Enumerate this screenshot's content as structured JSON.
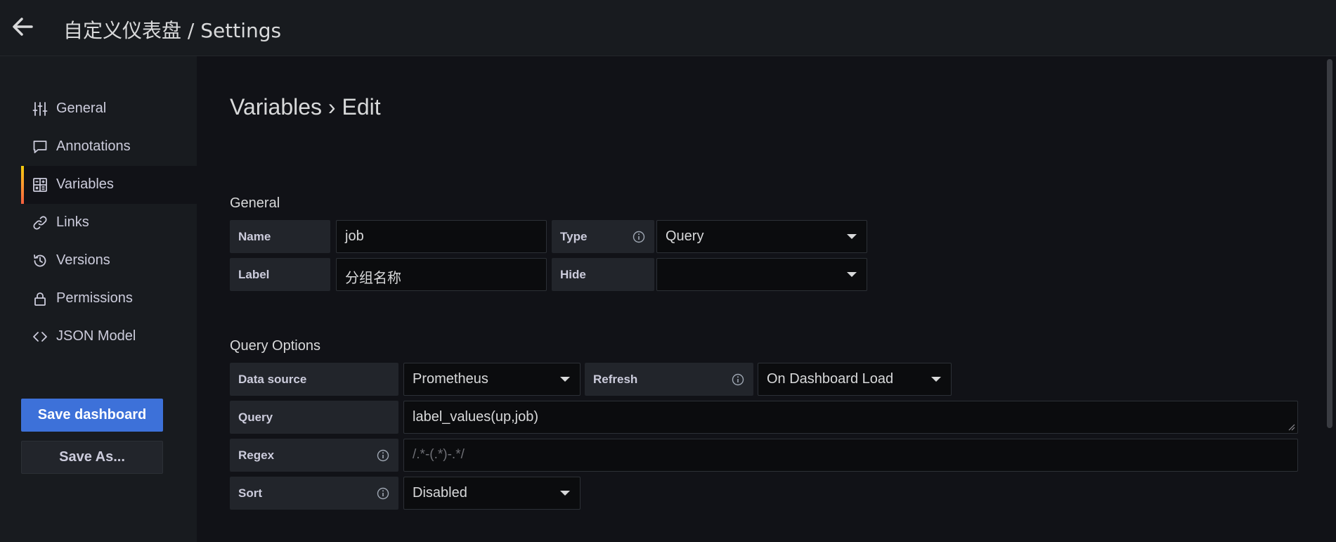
{
  "header": {
    "title": "自定义仪表盘 / Settings",
    "back_icon": "arrow-left-icon"
  },
  "sidebar": {
    "items": [
      {
        "label": "General",
        "icon": "sliders-icon",
        "active": false
      },
      {
        "label": "Annotations",
        "icon": "comment-icon",
        "active": false
      },
      {
        "label": "Variables",
        "icon": "calculator-icon",
        "active": true
      },
      {
        "label": "Links",
        "icon": "link-icon",
        "active": false
      },
      {
        "label": "Versions",
        "icon": "history-icon",
        "active": false
      },
      {
        "label": "Permissions",
        "icon": "lock-icon",
        "active": false
      },
      {
        "label": "JSON Model",
        "icon": "code-icon",
        "active": false
      }
    ],
    "save_button": "Save dashboard",
    "save_as_button": "Save As..."
  },
  "main": {
    "page_title": "Variables › Edit",
    "general": {
      "title": "General",
      "name_label": "Name",
      "name_value": "job",
      "type_label": "Type",
      "type_value": "Query",
      "label_label": "Label",
      "label_value": "分组名称",
      "hide_label": "Hide",
      "hide_value": ""
    },
    "query_options": {
      "title": "Query Options",
      "datasource_label": "Data source",
      "datasource_value": "Prometheus",
      "refresh_label": "Refresh",
      "refresh_value": "On Dashboard Load",
      "query_label": "Query",
      "query_value": "label_values(up,job)",
      "regex_label": "Regex",
      "regex_placeholder": "/.*-(.*)-.*/",
      "sort_label": "Sort",
      "sort_value": "Disabled"
    }
  },
  "colors": {
    "background": "#111217",
    "panel": "#181b1f",
    "primary": "#3d71d9",
    "accent_gradient": [
      "#f2cc0c",
      "#ff9830",
      "#f55f3e"
    ]
  }
}
